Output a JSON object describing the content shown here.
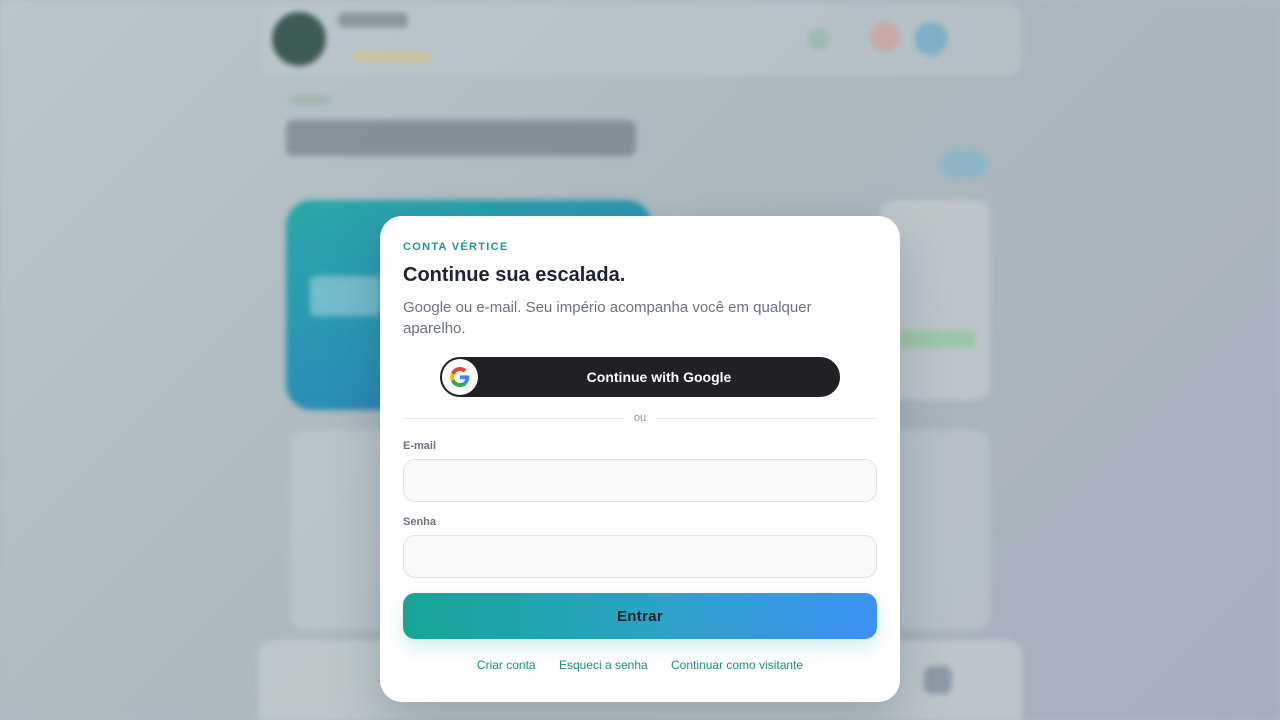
{
  "modal": {
    "eyebrow": "CONTA VÉRTICE",
    "title": "Continue sua escalada.",
    "description": "Google ou e-mail. Seu império acompanha você em qualquer aparelho.",
    "google_button_label": "Continue with Google",
    "google_icon": "google-g-icon",
    "divider_text": "ou",
    "email_label": "E-mail",
    "email_value": "",
    "password_label": "Senha",
    "password_value": "",
    "submit_label": "Entrar",
    "links": {
      "create_account": "Criar conta",
      "forgot_password": "Esqueci a senha",
      "guest": "Continuar como visitante"
    }
  },
  "colors": {
    "accent": "#1b9b8e",
    "google_button_bg": "#202124",
    "gradient_start": "#17a597",
    "gradient_end": "#3c92f4"
  }
}
